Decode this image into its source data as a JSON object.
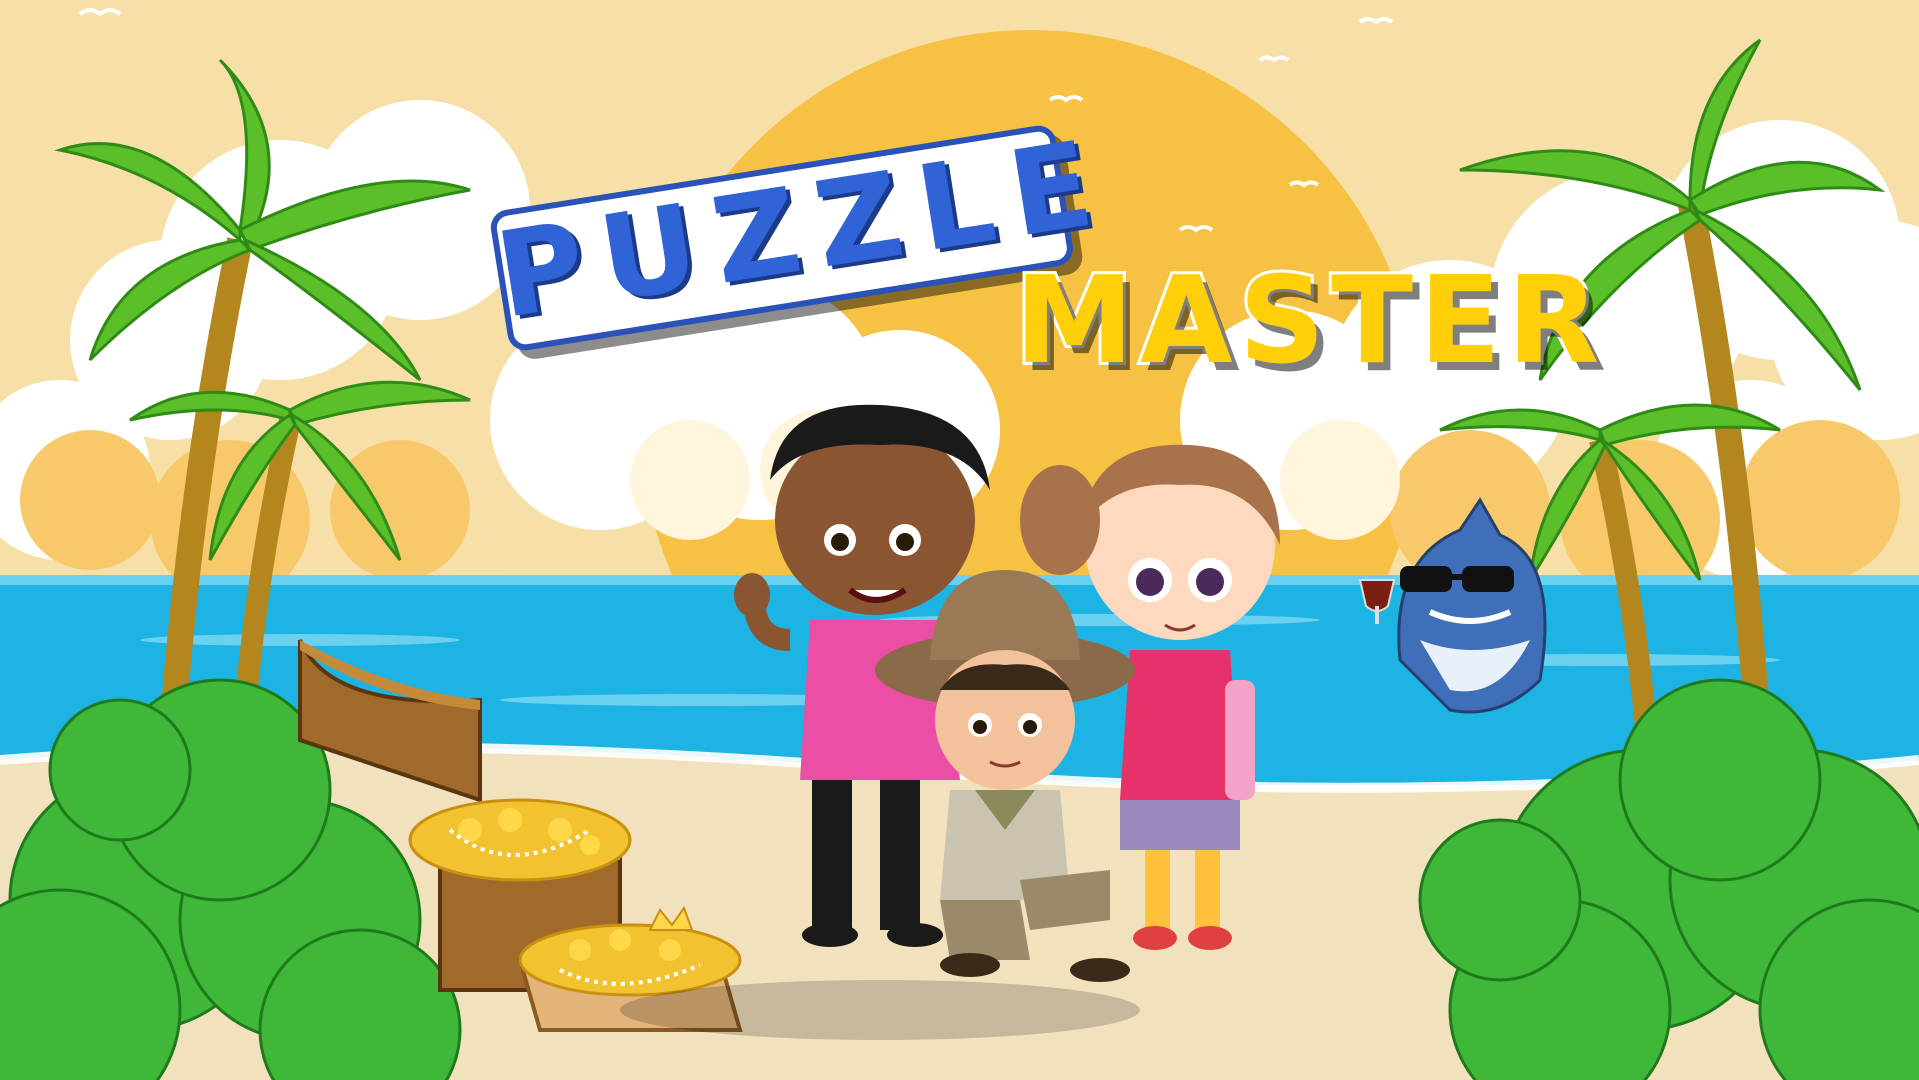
{
  "title": {
    "word1": "PUZZLE",
    "word2": "MASTER"
  },
  "colors": {
    "sky": "#f7dfa8",
    "sun": "#f7c244",
    "sea": "#1db3e3",
    "sand": "#f2e1bd",
    "puzzle_text": "#2f63d6",
    "master_text": "#ffcf0a",
    "palm_leaf": "#5bbf2a",
    "bush": "#3fb83a"
  },
  "scene": {
    "characters": [
      "boy-waving",
      "explorer-boy",
      "girl-backpack"
    ],
    "props": [
      "treasure-chest",
      "treasure-box",
      "shark-with-sunglasses"
    ]
  }
}
